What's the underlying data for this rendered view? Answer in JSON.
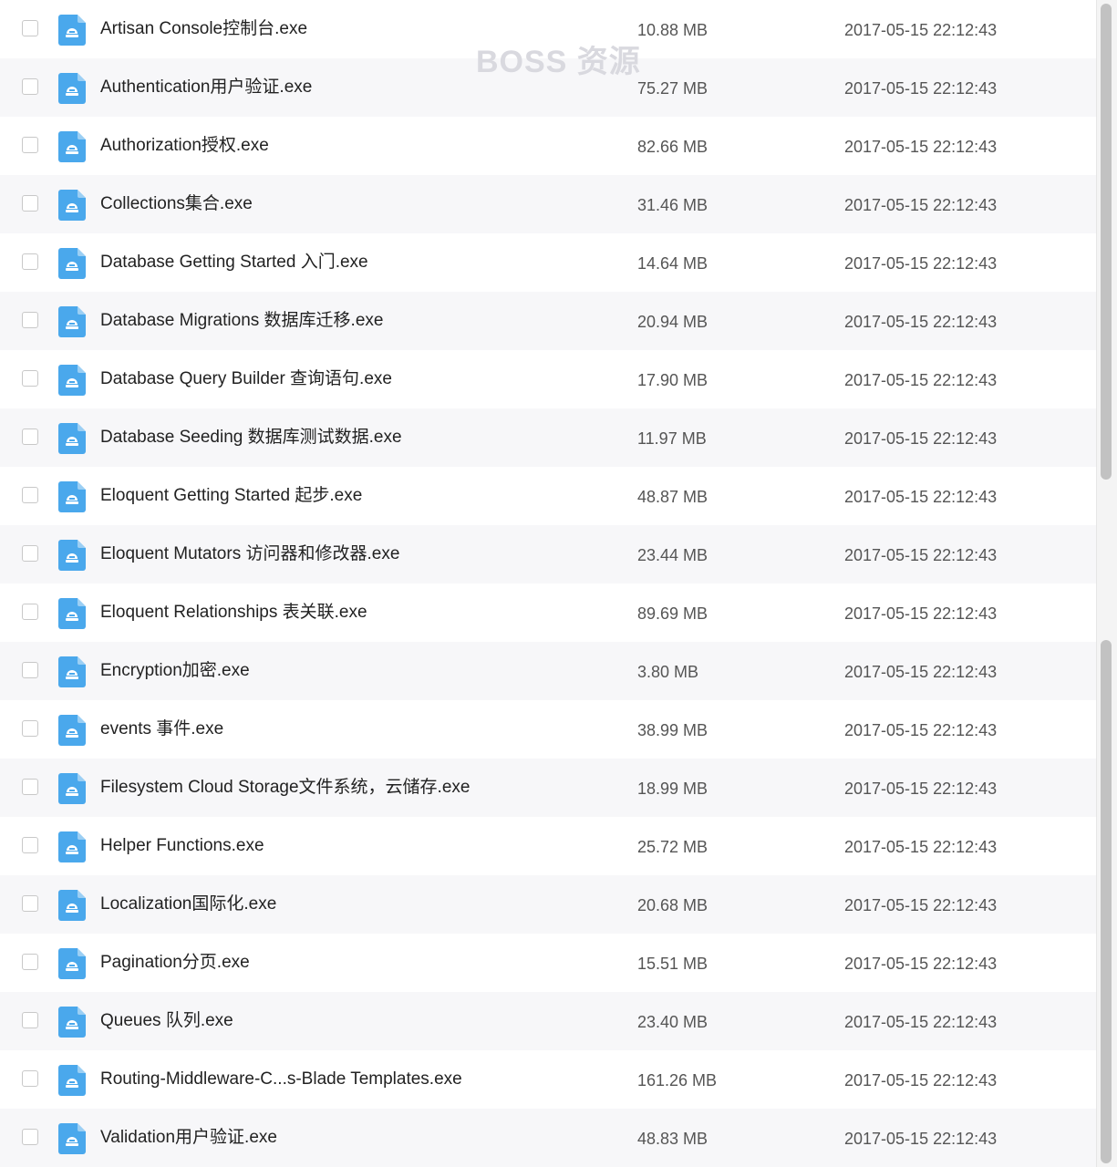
{
  "watermark": "BOSS 资源",
  "files": [
    {
      "name": "Artisan Console控制台.exe",
      "size": "10.88 MB",
      "date": "2017-05-15 22:12:43"
    },
    {
      "name": "Authentication用户验证.exe",
      "size": "75.27 MB",
      "date": "2017-05-15 22:12:43"
    },
    {
      "name": "Authorization授权.exe",
      "size": "82.66 MB",
      "date": "2017-05-15 22:12:43"
    },
    {
      "name": "Collections集合.exe",
      "size": "31.46 MB",
      "date": "2017-05-15 22:12:43"
    },
    {
      "name": "Database Getting Started 入门.exe",
      "size": "14.64 MB",
      "date": "2017-05-15 22:12:43"
    },
    {
      "name": "Database Migrations 数据库迁移.exe",
      "size": "20.94 MB",
      "date": "2017-05-15 22:12:43"
    },
    {
      "name": "Database Query Builder 查询语句.exe",
      "size": "17.90 MB",
      "date": "2017-05-15 22:12:43"
    },
    {
      "name": "Database Seeding 数据库测试数据.exe",
      "size": "11.97 MB",
      "date": "2017-05-15 22:12:43"
    },
    {
      "name": "Eloquent Getting Started 起步.exe",
      "size": "48.87 MB",
      "date": "2017-05-15 22:12:43"
    },
    {
      "name": "Eloquent Mutators 访问器和修改器.exe",
      "size": "23.44 MB",
      "date": "2017-05-15 22:12:43"
    },
    {
      "name": "Eloquent Relationships 表关联.exe",
      "size": "89.69 MB",
      "date": "2017-05-15 22:12:43"
    },
    {
      "name": "Encryption加密.exe",
      "size": "3.80 MB",
      "date": "2017-05-15 22:12:43"
    },
    {
      "name": "events 事件.exe",
      "size": "38.99 MB",
      "date": "2017-05-15 22:12:43"
    },
    {
      "name": "Filesystem  Cloud Storage文件系统，云储存.exe",
      "size": "18.99 MB",
      "date": "2017-05-15 22:12:43"
    },
    {
      "name": "Helper Functions.exe",
      "size": "25.72 MB",
      "date": "2017-05-15 22:12:43"
    },
    {
      "name": "Localization国际化.exe",
      "size": "20.68 MB",
      "date": "2017-05-15 22:12:43"
    },
    {
      "name": "Pagination分页.exe",
      "size": "15.51 MB",
      "date": "2017-05-15 22:12:43"
    },
    {
      "name": "Queues 队列.exe",
      "size": "23.40 MB",
      "date": "2017-05-15 22:12:43"
    },
    {
      "name": "Routing-Middleware-C...s-Blade Templates.exe",
      "size": "161.26 MB",
      "date": "2017-05-15 22:12:43"
    },
    {
      "name": "Validation用户验证.exe",
      "size": "48.83 MB",
      "date": "2017-05-15 22:12:43"
    }
  ],
  "colors": {
    "icon_blue": "#4aa8ec",
    "row_alt": "#f7f7f9",
    "text": "#222222",
    "meta_text": "#555555"
  },
  "icons": {
    "file": "exe-file-icon",
    "checkbox": "checkbox-empty"
  }
}
